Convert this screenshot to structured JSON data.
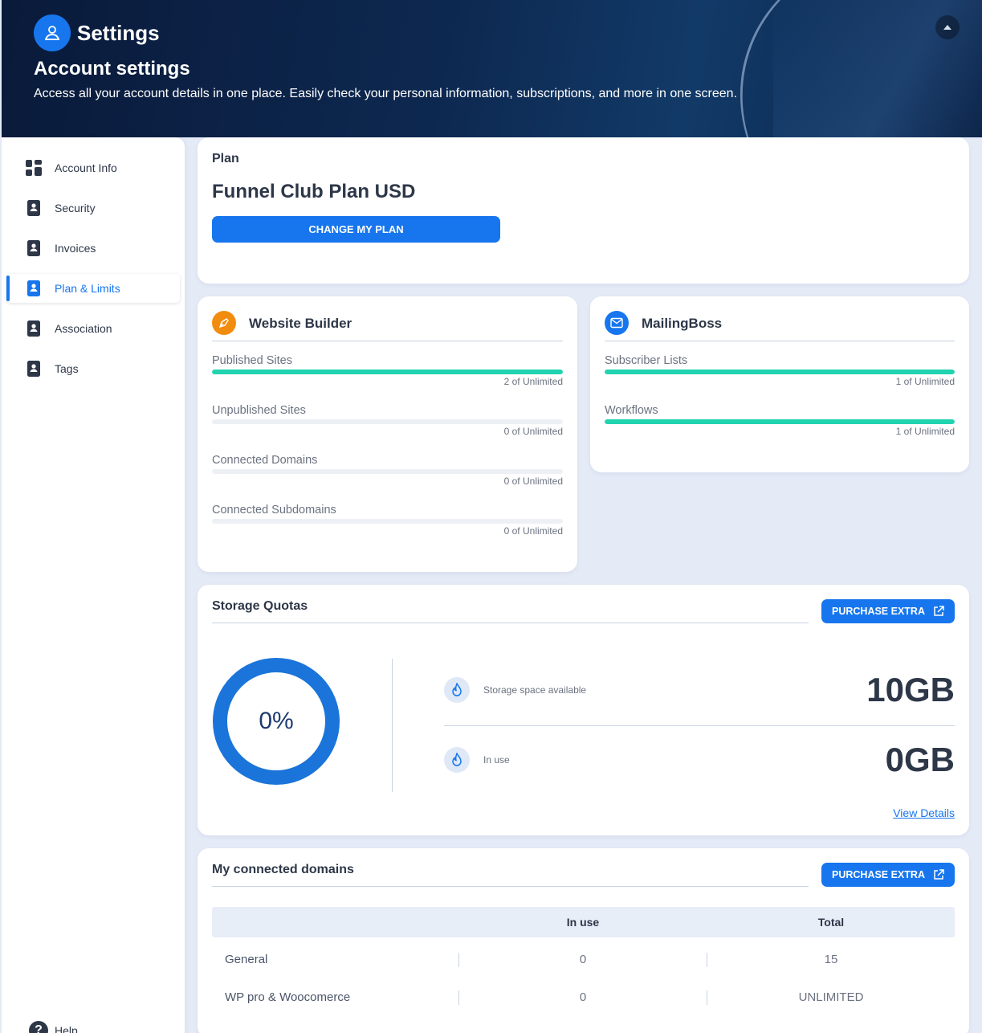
{
  "header": {
    "app_title": "Settings",
    "page_title": "Account settings",
    "description": "Access all your account details in one place. Easily check your personal information, subscriptions, and more in one screen."
  },
  "sidebar": {
    "items": [
      {
        "label": "Account Info",
        "icon": "grid-icon"
      },
      {
        "label": "Security",
        "icon": "contact-book-icon"
      },
      {
        "label": "Invoices",
        "icon": "contact-book-icon"
      },
      {
        "label": "Plan & Limits",
        "icon": "contact-book-icon",
        "active": true
      },
      {
        "label": "Association",
        "icon": "contact-book-icon"
      },
      {
        "label": "Tags",
        "icon": "contact-book-icon"
      }
    ],
    "help_label": "Help"
  },
  "plan": {
    "section_label": "Plan",
    "name": "Funnel Club Plan USD",
    "change_button": "CHANGE MY PLAN"
  },
  "website_builder": {
    "title": "Website Builder",
    "usages": [
      {
        "label": "Published Sites",
        "value": "2 of Unlimited",
        "fill": 1
      },
      {
        "label": "Unpublished Sites",
        "value": "0 of Unlimited",
        "fill": 0
      },
      {
        "label": "Connected Domains",
        "value": "0 of Unlimited",
        "fill": 0
      },
      {
        "label": "Connected Subdomains",
        "value": "0 of Unlimited",
        "fill": 0
      }
    ]
  },
  "mailingboss": {
    "title": "MailingBoss",
    "usages": [
      {
        "label": "Subscriber Lists",
        "value": "1 of Unlimited",
        "fill": 1
      },
      {
        "label": "Workflows",
        "value": "1 of Unlimited",
        "fill": 1
      }
    ]
  },
  "storage": {
    "title": "Storage Quotas",
    "purchase_button": "PURCHASE EXTRA",
    "percent_used": "0%",
    "available_label": "Storage space available",
    "available_value": "10GB",
    "in_use_label": "In use",
    "in_use_value": "0GB",
    "view_details": "View Details"
  },
  "domains": {
    "title": "My connected domains",
    "purchase_button": "PURCHASE EXTRA",
    "columns": {
      "in_use": "In use",
      "total": "Total"
    },
    "rows": [
      {
        "name": "General",
        "in_use": "0",
        "total": "15"
      },
      {
        "name": "WP pro & Woocomerce",
        "in_use": "0",
        "total": "UNLIMITED"
      }
    ]
  },
  "colors": {
    "accent": "#1776ee",
    "progress": "#22d3b0",
    "header_bg": "#0d2850",
    "website_builder_icon": "#f28c0f",
    "donut": "#1b74d9"
  }
}
